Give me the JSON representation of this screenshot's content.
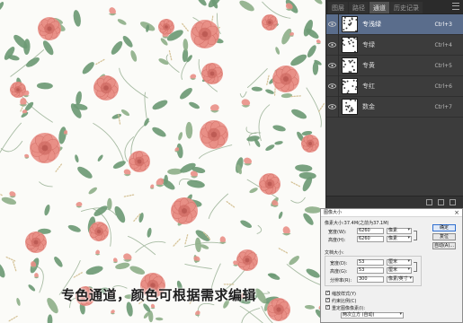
{
  "channels_panel": {
    "tabs": [
      "图层",
      "路径",
      "通道",
      "历史记录"
    ],
    "active_tab": "通道",
    "channels": [
      {
        "name": "专浅绿",
        "shortcut": "Ctrl+3",
        "selected": true
      },
      {
        "name": "专绿",
        "shortcut": "Ctrl+4",
        "selected": false
      },
      {
        "name": "专黄",
        "shortcut": "Ctrl+5",
        "selected": false
      },
      {
        "name": "专红",
        "shortcut": "Ctrl+6",
        "selected": false
      },
      {
        "name": "数金",
        "shortcut": "Ctrl+7",
        "selected": false
      }
    ],
    "accent_color": "#5a6d8c"
  },
  "image_size_dialog": {
    "title": "图像大小",
    "close_label": "×",
    "pixel_dimensions": "像素大小:37.4M(之前为37.1M)",
    "width_label": "宽度(W):",
    "width_value": "6260",
    "width_unit": "像素",
    "height_label": "高度(H):",
    "height_value": "6260",
    "height_unit": "像素",
    "doc_size_label": "文档大小:",
    "doc_width_label": "宽度(D):",
    "doc_width_value": "53",
    "doc_width_unit": "厘米",
    "doc_height_label": "高度(G):",
    "doc_height_value": "53",
    "doc_height_unit": "厘米",
    "resolution_label": "分辨率(R):",
    "resolution_value": "300",
    "resolution_unit": "像素/英寸",
    "scale_styles": "缩放样式(Y)",
    "constrain": "约束比例(C)",
    "resample": "重定图像像素(I):",
    "resample_method": "两次立方 (自动)",
    "ok_label": "确定",
    "reset_label": "复位",
    "auto_label": "自动(A)..."
  },
  "caption": {
    "text": "专色通道，颜色可根据需求编辑"
  },
  "colors": {
    "rose": "#e98f86",
    "rose_dark": "#cf6b63",
    "leaf": "#6e9a75",
    "bud_green": "#8fb08a",
    "stem": "#9fb59a",
    "wheat": "#d6c49a"
  }
}
